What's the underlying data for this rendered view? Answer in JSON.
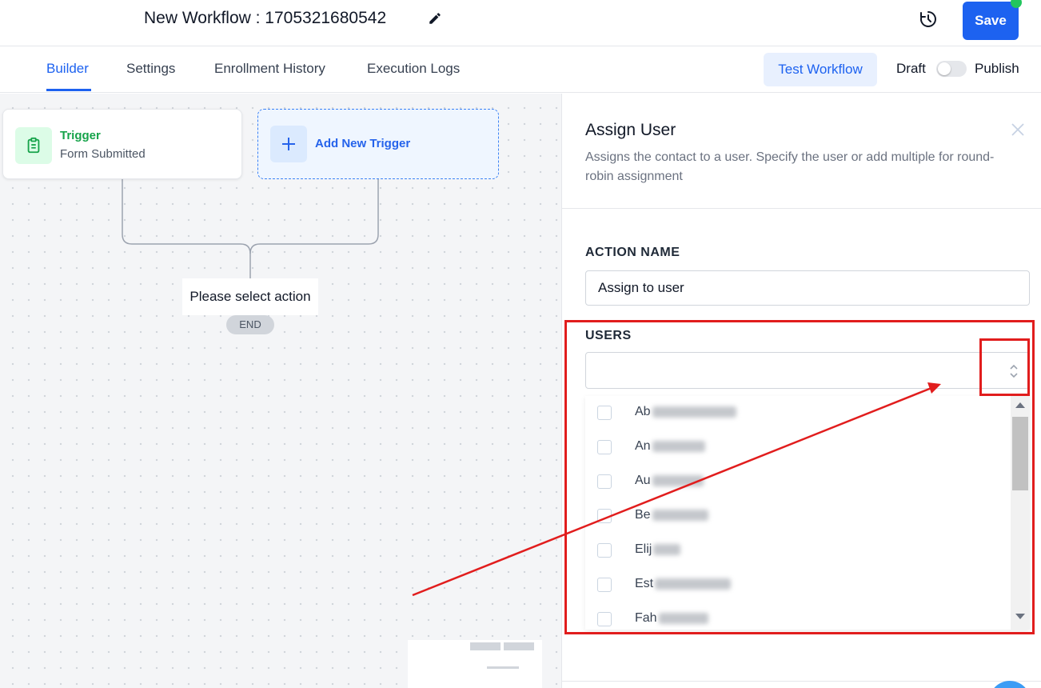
{
  "header": {
    "workflow_title": "New Workflow : 1705321680542",
    "save_label": "Save",
    "status_dot_color": "#22c55e"
  },
  "tabs": [
    {
      "label": "Builder",
      "active": true
    },
    {
      "label": "Settings",
      "active": false
    },
    {
      "label": "Enrollment History",
      "active": false
    },
    {
      "label": "Execution Logs",
      "active": false
    }
  ],
  "toolbar": {
    "test_label": "Test Workflow",
    "draft_label": "Draft",
    "publish_label": "Publish",
    "publish_toggle_on": false
  },
  "canvas": {
    "trigger": {
      "title": "Trigger",
      "subtitle": "Form Submitted"
    },
    "add_trigger_label": "Add New Trigger",
    "placeholder_action": "Please select action",
    "end_label": "END"
  },
  "panel": {
    "title": "Assign User",
    "description": "Assigns the contact to a user. Specify the user or add multiple for round-robin assignment",
    "action_name_label": "ACTION NAME",
    "action_name_value": "Assign to user",
    "users_label": "USERS",
    "users_value": "",
    "user_options": [
      "Ab",
      "An",
      "Au",
      "Be",
      "Elij",
      "Est",
      "Fah"
    ]
  },
  "colors": {
    "accent": "#1d62f0",
    "trigger_green": "#16a34a",
    "annotation_red": "#e11d1d"
  }
}
